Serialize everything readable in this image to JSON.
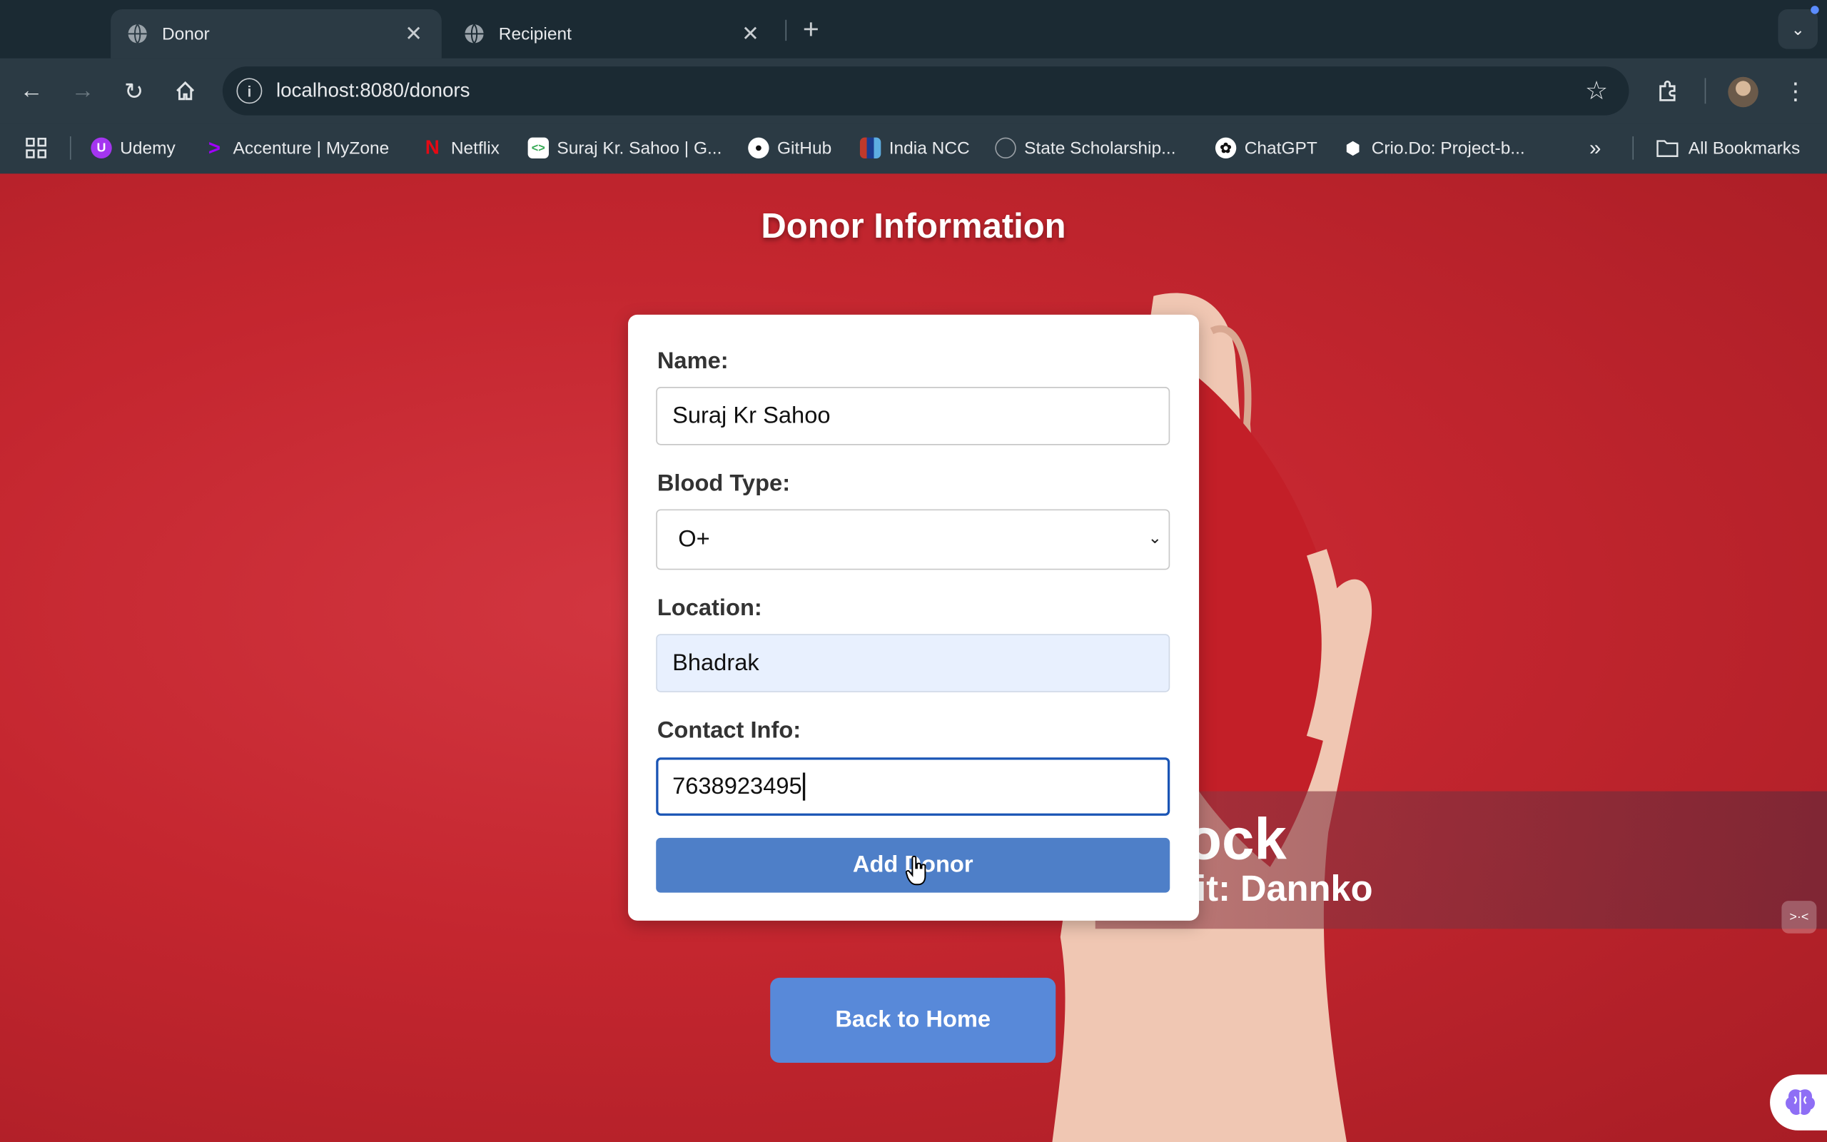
{
  "tabs": [
    {
      "title": "Donor",
      "active": true
    },
    {
      "title": "Recipient",
      "active": false
    }
  ],
  "address_bar": {
    "url": "localhost:8080/donors"
  },
  "bookmarks": [
    {
      "label": "Udemy",
      "icon": "udemy-icon",
      "color": "#a435f0"
    },
    {
      "label": "Accenture | MyZone",
      "icon": "accenture-icon",
      "color": "#a100ff"
    },
    {
      "label": "Netflix",
      "icon": "netflix-icon",
      "color": "#e50914"
    },
    {
      "label": "Suraj Kr. Sahoo | G...",
      "icon": "site-icon",
      "color": "#34a853"
    },
    {
      "label": "GitHub",
      "icon": "github-icon",
      "color": "#ffffff"
    },
    {
      "label": "India NCC",
      "icon": "ncc-icon",
      "color": "#c0392b"
    },
    {
      "label": "State Scholarship...",
      "icon": "scholarship-icon",
      "color": "#9aa0a6"
    },
    {
      "label": "ChatGPT",
      "icon": "chatgpt-icon",
      "color": "#ffffff"
    },
    {
      "label": "Crio.Do: Project-b...",
      "icon": "crio-icon",
      "color": "#ffffff"
    }
  ],
  "all_bookmarks": "All Bookmarks",
  "page": {
    "heading": "Donor Information",
    "form": {
      "name_label": "Name:",
      "name_value": "Suraj Kr Sahoo",
      "blood_label": "Blood Type:",
      "blood_value": "O+",
      "location_label": "Location:",
      "location_value": "Bhadrak",
      "contact_label": "Contact Info:",
      "contact_value": "7638923495",
      "submit_label": "Add Donor"
    },
    "home_button": "Back to Home",
    "background_text": {
      "line1": "ock",
      "line2": "lit: Dannko"
    }
  },
  "colors": {
    "page_bg": "#c4262f",
    "button": "#4e7fc8",
    "home_button": "#5889d9"
  }
}
